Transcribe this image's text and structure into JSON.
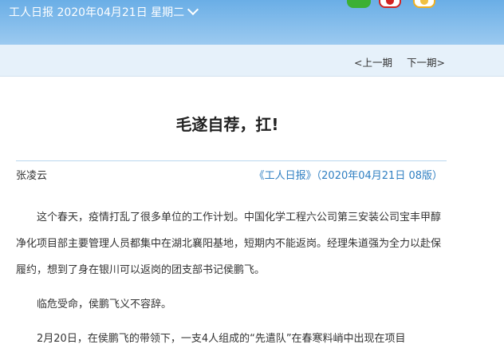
{
  "header": {
    "title": "工人日报 2020年04月21日 星期二",
    "share_icons": [
      "wechat-icon",
      "weibo-icon",
      "qzone-icon"
    ]
  },
  "pager": {
    "prev": "<上一期",
    "next": "下一期>"
  },
  "article": {
    "title": "毛遂自荐，扛!",
    "author": "张凌云",
    "source": "《工人日报》（2020年04月21日 08版）",
    "paragraphs": [
      "这个春天，疫情打乱了很多单位的工作计划。中国化学工程六公司第三安装公司宝丰甲醇净化项目部主要管理人员都集中在湖北襄阳基地，短期内不能返岗。经理朱道强为全力以赴保履约，想到了身在银川可以返岗的团支部书记侯鹏飞。",
      "临危受命，侯鹏飞义不容辞。",
      "2月20日，在侯鹏飞的带领下，一支4人组成的“先遣队”在春寒料峭中出现在项目"
    ]
  },
  "colors": {
    "header_gradient_top": "#6aaee6",
    "header_gradient_bottom": "#9ccaf0",
    "nav_band": "#e6f1fa",
    "source_link": "#2f7fc2",
    "divider": "#b9d6ee"
  }
}
